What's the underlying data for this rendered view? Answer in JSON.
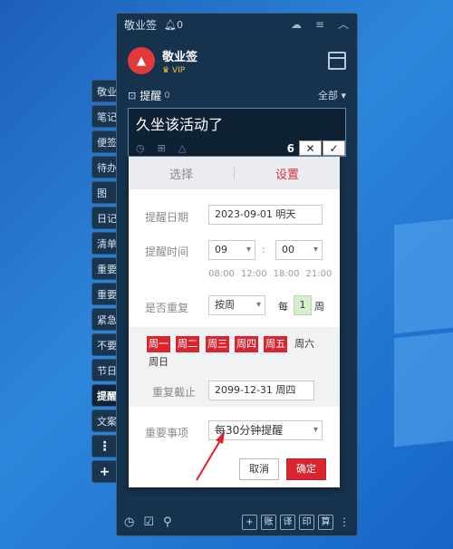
{
  "app": {
    "title": "敬业签",
    "bell_count": "0"
  },
  "profile": {
    "name": "敬业签",
    "vip": "VIP",
    "avatar_glyph": "▲"
  },
  "sidebar": {
    "tabs": [
      {
        "label": "敬业"
      },
      {
        "label": "笔记"
      },
      {
        "label": "便签"
      },
      {
        "label": "待办"
      },
      {
        "label": "图"
      },
      {
        "label": "日记"
      },
      {
        "label": "清单"
      },
      {
        "label": "重要"
      },
      {
        "label": "重要"
      },
      {
        "label": "紧急"
      },
      {
        "label": "不要"
      },
      {
        "label": "节日"
      },
      {
        "label": "提醒"
      },
      {
        "label": "文案"
      }
    ],
    "more": "⋮",
    "add": "+"
  },
  "remind": {
    "title": "提醒",
    "count": "0",
    "filter": "全部"
  },
  "note": {
    "text": "久坐该活动了",
    "count": "6",
    "cancel": "✕",
    "ok": "✓"
  },
  "dialog": {
    "tab_select": "选择",
    "tab_settings": "设置",
    "date_label": "提醒日期",
    "date_value": "2023-09-01 明天",
    "time_label": "提醒时间",
    "hour": "09",
    "minute": "00",
    "colon": ":",
    "time_hints": [
      "08:00",
      "12:00",
      "18:00",
      "21:00"
    ],
    "repeat_label": "是否重复",
    "repeat_value": "按周",
    "every": "每",
    "every_n": "1",
    "week": "周",
    "weekdays": [
      "周一",
      "周二",
      "周三",
      "周四",
      "周五",
      "周六",
      "周日"
    ],
    "repeat_end_label": "重复截止",
    "repeat_end_value": "2099-12-31 周四",
    "important_label": "重要事项",
    "important_value": "每30分钟提醒",
    "cancel": "取消",
    "confirm": "确定"
  },
  "bottom": {
    "btns": [
      "+",
      "账",
      "译",
      "印",
      "算"
    ]
  },
  "colors": {
    "accent": "#d9262e",
    "panel": "#17324c"
  }
}
